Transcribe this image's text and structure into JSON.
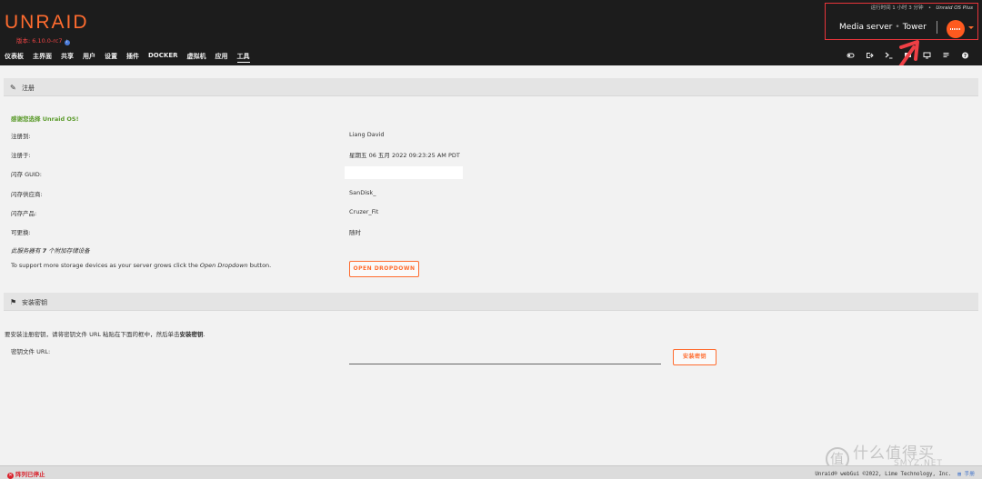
{
  "header": {
    "logo": "UNRAID",
    "version": "版本: 6.10.0-rc7",
    "uptime_text": "运行时间 1 小时 3 分钟",
    "uptime_sep": "•",
    "plan": "Unraid OS Plus",
    "server_description": "Media server",
    "server_sep": "•",
    "server_name": "Tower"
  },
  "nav": {
    "items": [
      "仪表板",
      "主界面",
      "共享",
      "用户",
      "设置",
      "插件",
      "DOCKER",
      "虚拟机",
      "应用",
      "工具"
    ],
    "active": "工具"
  },
  "tool_icons": [
    "switch-icon",
    "logout-icon",
    "terminal-icon",
    "feedback-icon",
    "monitor-icon",
    "notes-icon",
    "help-icon"
  ],
  "registration": {
    "section_title": "注册",
    "thanks": "感谢您选择 Unraid OS!",
    "rows": [
      {
        "label": "注册到:",
        "value": "Liang David"
      },
      {
        "label": "注册于:",
        "value": "星期五 06 五月 2022 09:23:25 AM PDT"
      },
      {
        "label": "闪存 GUID:",
        "value": ""
      },
      {
        "label": "闪存供应商:",
        "value": "SanDisk_"
      },
      {
        "label": "闪存产品:",
        "value": "Cruzer_Fit"
      },
      {
        "label": "可更换:",
        "value": "随时"
      }
    ],
    "devices_note_prefix": "此服务器有",
    "devices_count": "7",
    "devices_note_suffix": "个附加存储设备",
    "upgrade_note_prefix": "To support more storage devices as your server grows click the",
    "upgrade_note_em": "Open Dropdown",
    "upgrade_note_suffix": "button.",
    "open_dropdown_label": "OPEN DROPDOWN"
  },
  "install_key": {
    "section_title": "安装密钥",
    "desc_prefix": "要安装注册密钥，请将密钥文件 URL 粘贴在下面的框中，然后单击",
    "desc_bold": "安装密钥",
    "desc_suffix": ".",
    "url_label": "密钥文件 URL:",
    "url_value": "",
    "install_button": "安装密钥"
  },
  "footer": {
    "array_status": "阵列已停止",
    "copyright": "Unraid® webGui ©2022, Lime Technology, Inc.",
    "manual": "手册"
  },
  "watermark": {
    "glyph": "值",
    "text": "什么值得买",
    "sub": "SMYZ.NET"
  },
  "colors": {
    "accent": "#ff6c2f",
    "highlight_box": "#e8343a",
    "success": "#5a9a2a",
    "error": "#d9232d"
  }
}
